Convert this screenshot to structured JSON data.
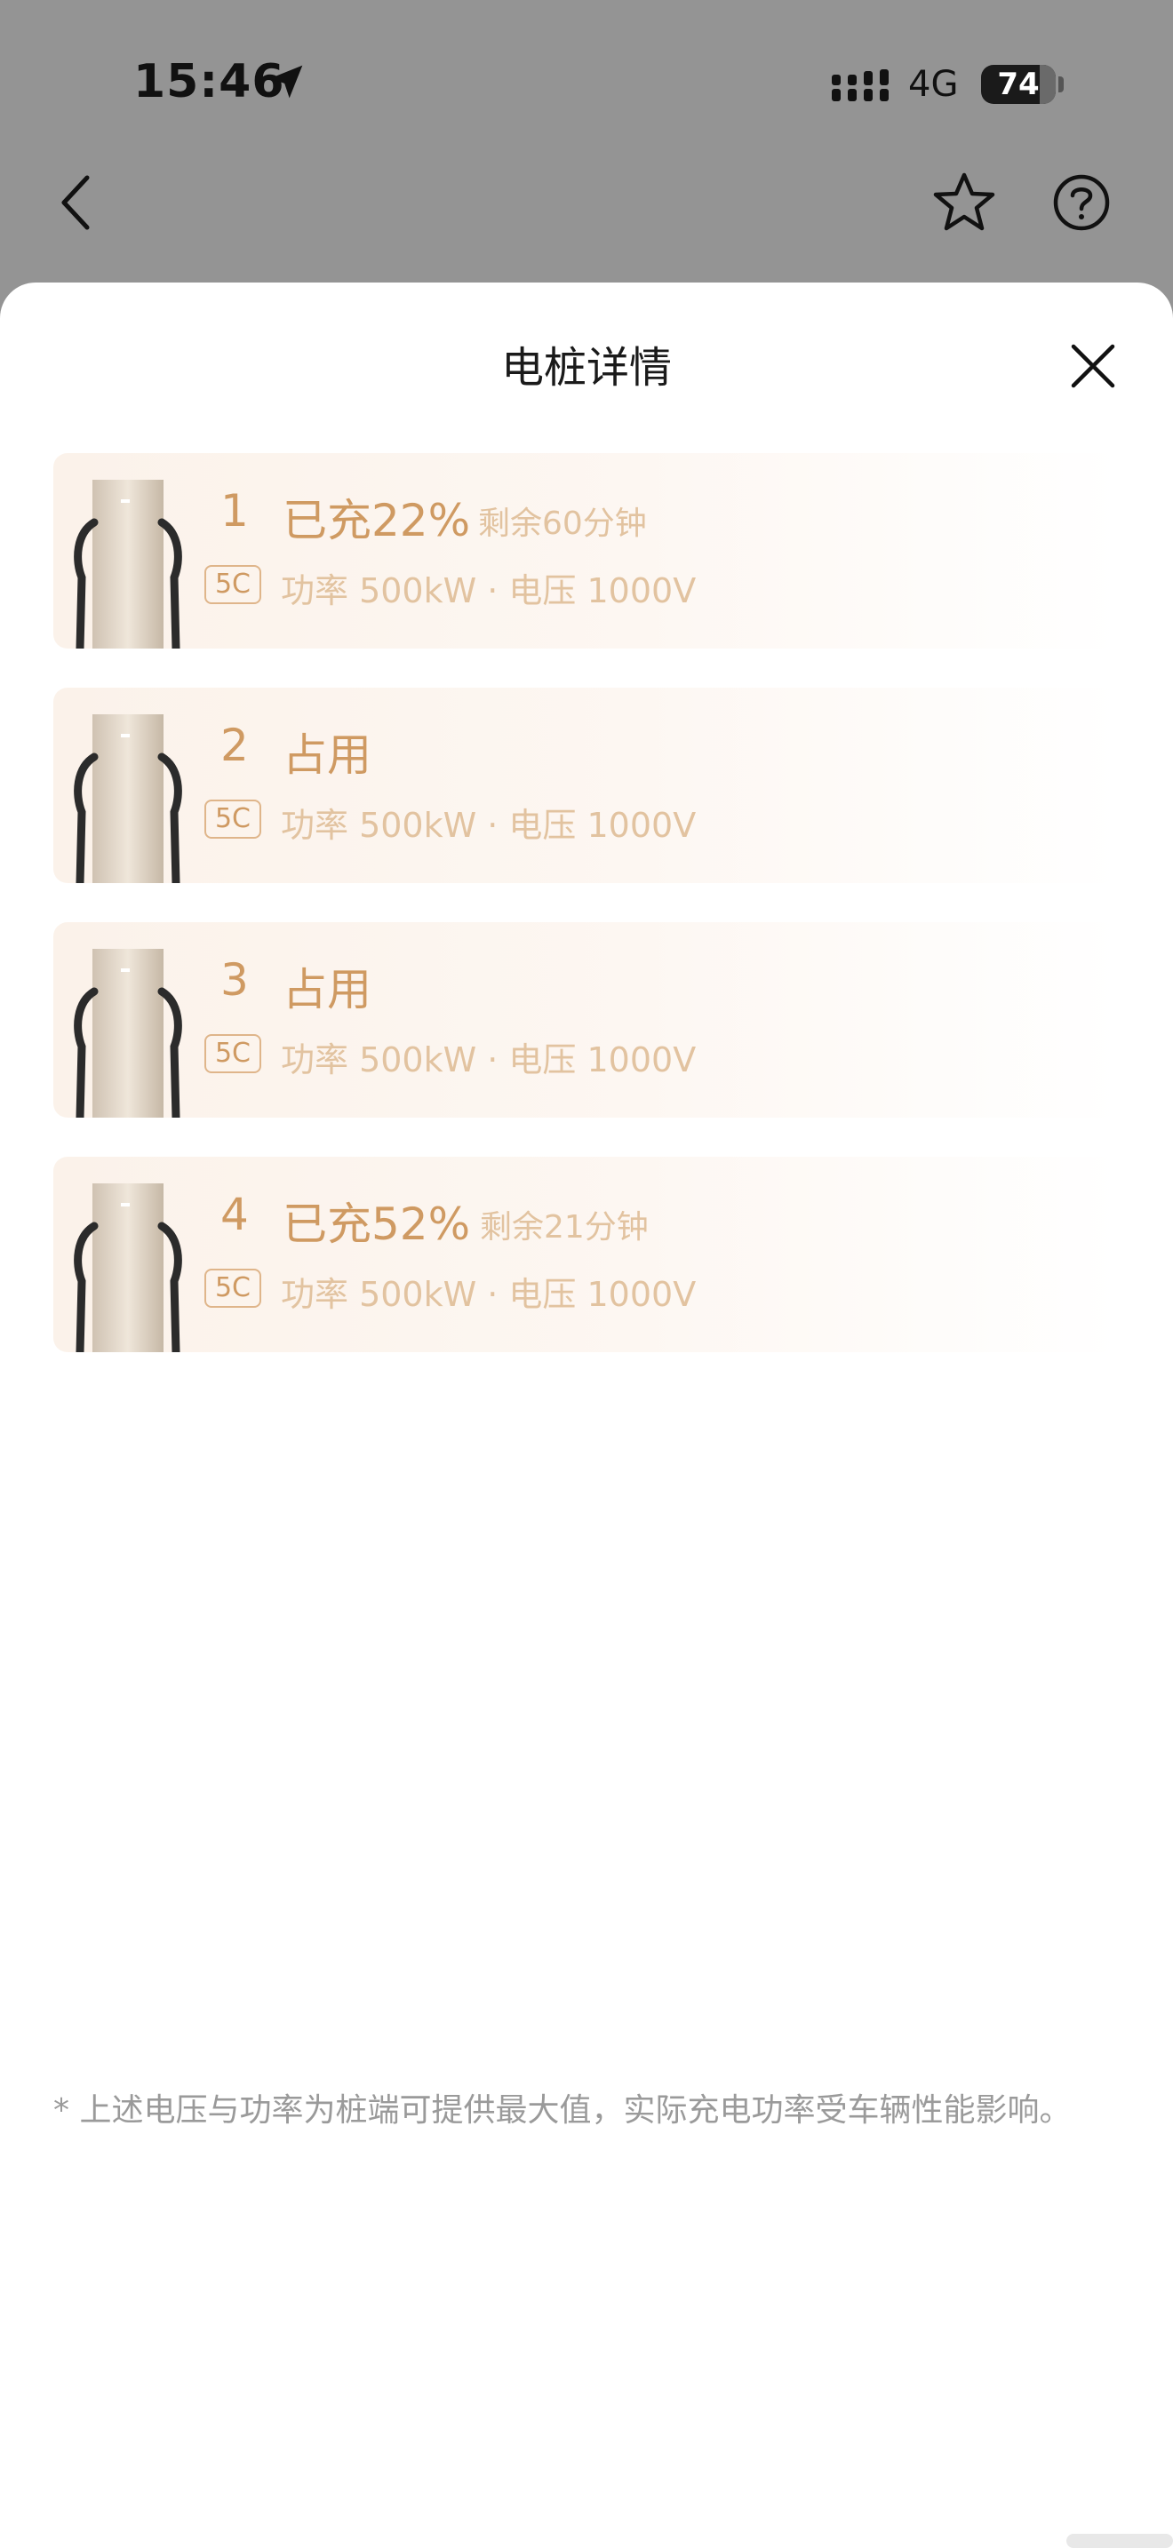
{
  "status_bar": {
    "time": "15:46",
    "network": "4G",
    "battery": "74",
    "battery_level": 0.74
  },
  "nav": {
    "back_icon": "chevron-left-icon",
    "favorite_icon": "star-icon",
    "help_icon": "question-circle-icon"
  },
  "sheet": {
    "title": "电桩详情",
    "close_icon": "close-icon",
    "piles": [
      {
        "number": "1",
        "status": "已充22%",
        "remaining": "剩余60分钟",
        "badge": "5C",
        "spec": "功率 500kW · 电压 1000V"
      },
      {
        "number": "2",
        "status": "占用",
        "remaining": "",
        "badge": "5C",
        "spec": "功率 500kW · 电压 1000V"
      },
      {
        "number": "3",
        "status": "占用",
        "remaining": "",
        "badge": "5C",
        "spec": "功率 500kW · 电压 1000V"
      },
      {
        "number": "4",
        "status": "已充52%",
        "remaining": "剩余21分钟",
        "badge": "5C",
        "spec": "功率 500kW · 电压 1000V"
      }
    ],
    "footnote": "* 上述电压与功率为桩端可提供最大值，实际充电功率受车辆性能影响。"
  },
  "colors": {
    "accent": "#cf9a62",
    "accent_light": "#e2c3a0",
    "overlay": "#949494"
  }
}
